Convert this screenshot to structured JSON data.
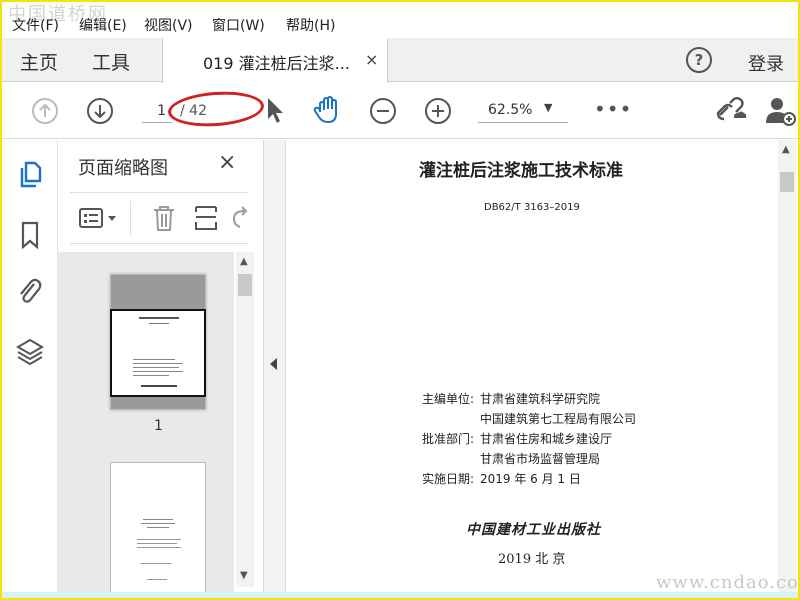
{
  "watermark_top": "中国道桥网",
  "watermark_bottom": "www.cndao.com",
  "menu": [
    "文件(F)",
    "编辑(E)",
    "视图(V)",
    "窗口(W)",
    "帮助(H)"
  ],
  "tabs": {
    "home": "主页",
    "tools": "工具",
    "document": "019 灌注桩后注浆...",
    "close": "×"
  },
  "header": {
    "help": "?",
    "login": "登录"
  },
  "toolbar": {
    "page_current": "1",
    "page_total": "/ 42",
    "zoom": "62.5%",
    "zoom_caret": "▼",
    "more": "•••",
    "annotation_color": "#d32020"
  },
  "thumbnails": {
    "title": "页面缩略图",
    "close": "×",
    "page_number": "1"
  },
  "document": {
    "title": "灌注桩后注浆施工技术标准",
    "code": "DB62/T  3163–2019",
    "info": [
      {
        "label": "主编单位:",
        "value": "甘肃省建筑科学研究院"
      },
      {
        "label": "",
        "value": "中国建筑第七工程局有限公司"
      },
      {
        "label": "批准部门:",
        "value": "甘肃省住房和城乡建设厅"
      },
      {
        "label": "",
        "value": "甘肃省市场监督管理局"
      },
      {
        "label": "实施日期:",
        "value": "2019 年 6 月 1 日"
      }
    ],
    "publisher": "中国建材工业出版社",
    "year_city": "2019   北   京"
  },
  "icons": {
    "up": "arrow-up-icon",
    "down": "arrow-down-icon",
    "select": "pointer-icon",
    "hand": "hand-icon",
    "zoom_out": "zoom-out-icon",
    "zoom_in": "zoom-in-icon",
    "share": "share-link-icon",
    "user": "add-user-icon",
    "pages": "pages-icon",
    "bookmark": "bookmark-icon",
    "attach": "paperclip-icon",
    "layers": "layers-icon"
  }
}
